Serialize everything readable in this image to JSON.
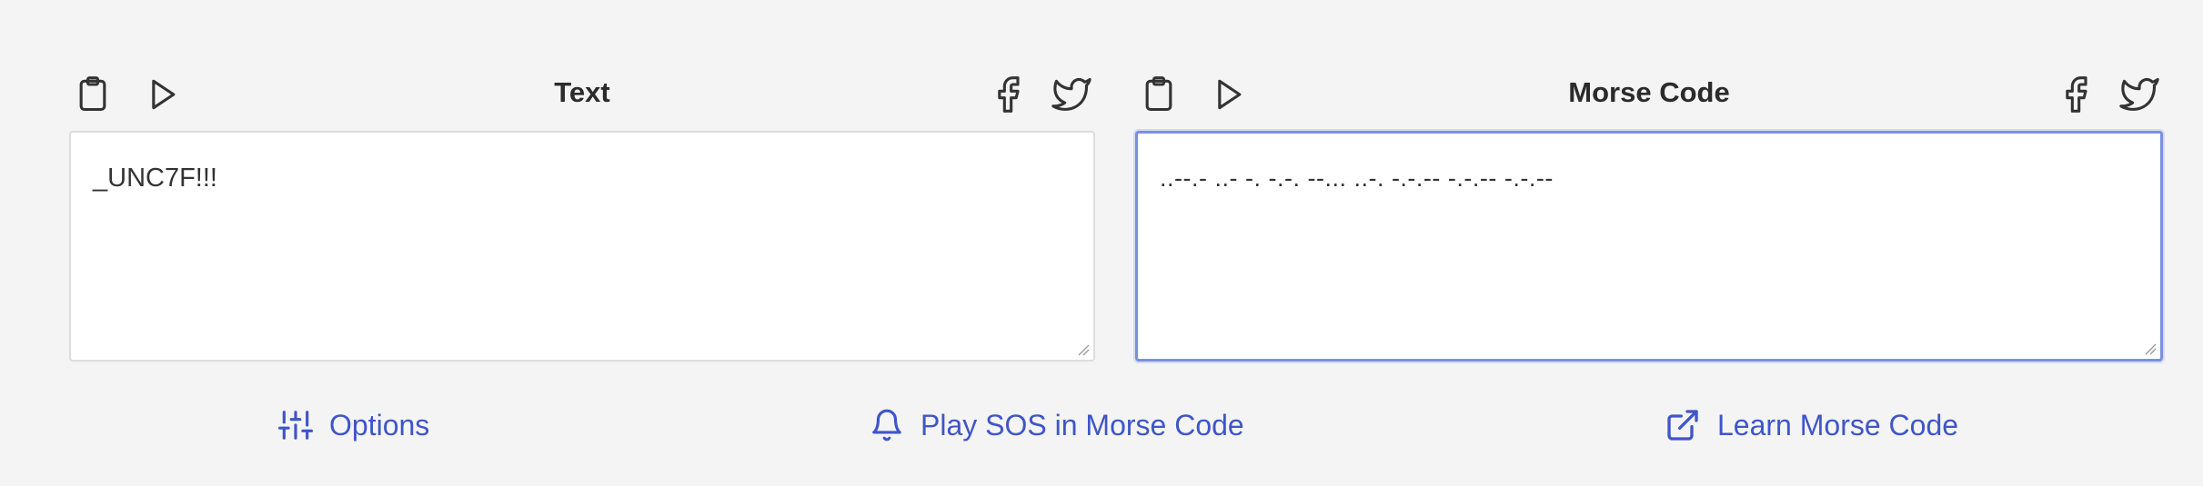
{
  "left_panel": {
    "title": "Text",
    "value": "_UNC7F!!!",
    "icons": [
      "clipboard-icon",
      "play-icon",
      "facebook-icon",
      "twitter-icon"
    ]
  },
  "right_panel": {
    "title": "Morse Code",
    "value": "..--.- ..- -. -.-. --... ..-. -.-.-- -.-.-- -.-.--",
    "icons": [
      "clipboard-icon",
      "play-icon",
      "facebook-icon",
      "twitter-icon"
    ]
  },
  "footer": {
    "options_label": "Options",
    "sos_label": "Play SOS in Morse Code",
    "learn_label": "Learn Morse Code"
  },
  "colors": {
    "background": "#f4f4f4",
    "accent": "#3f55c9",
    "focus_border": "#7b8fe0",
    "icon": "#333333"
  }
}
